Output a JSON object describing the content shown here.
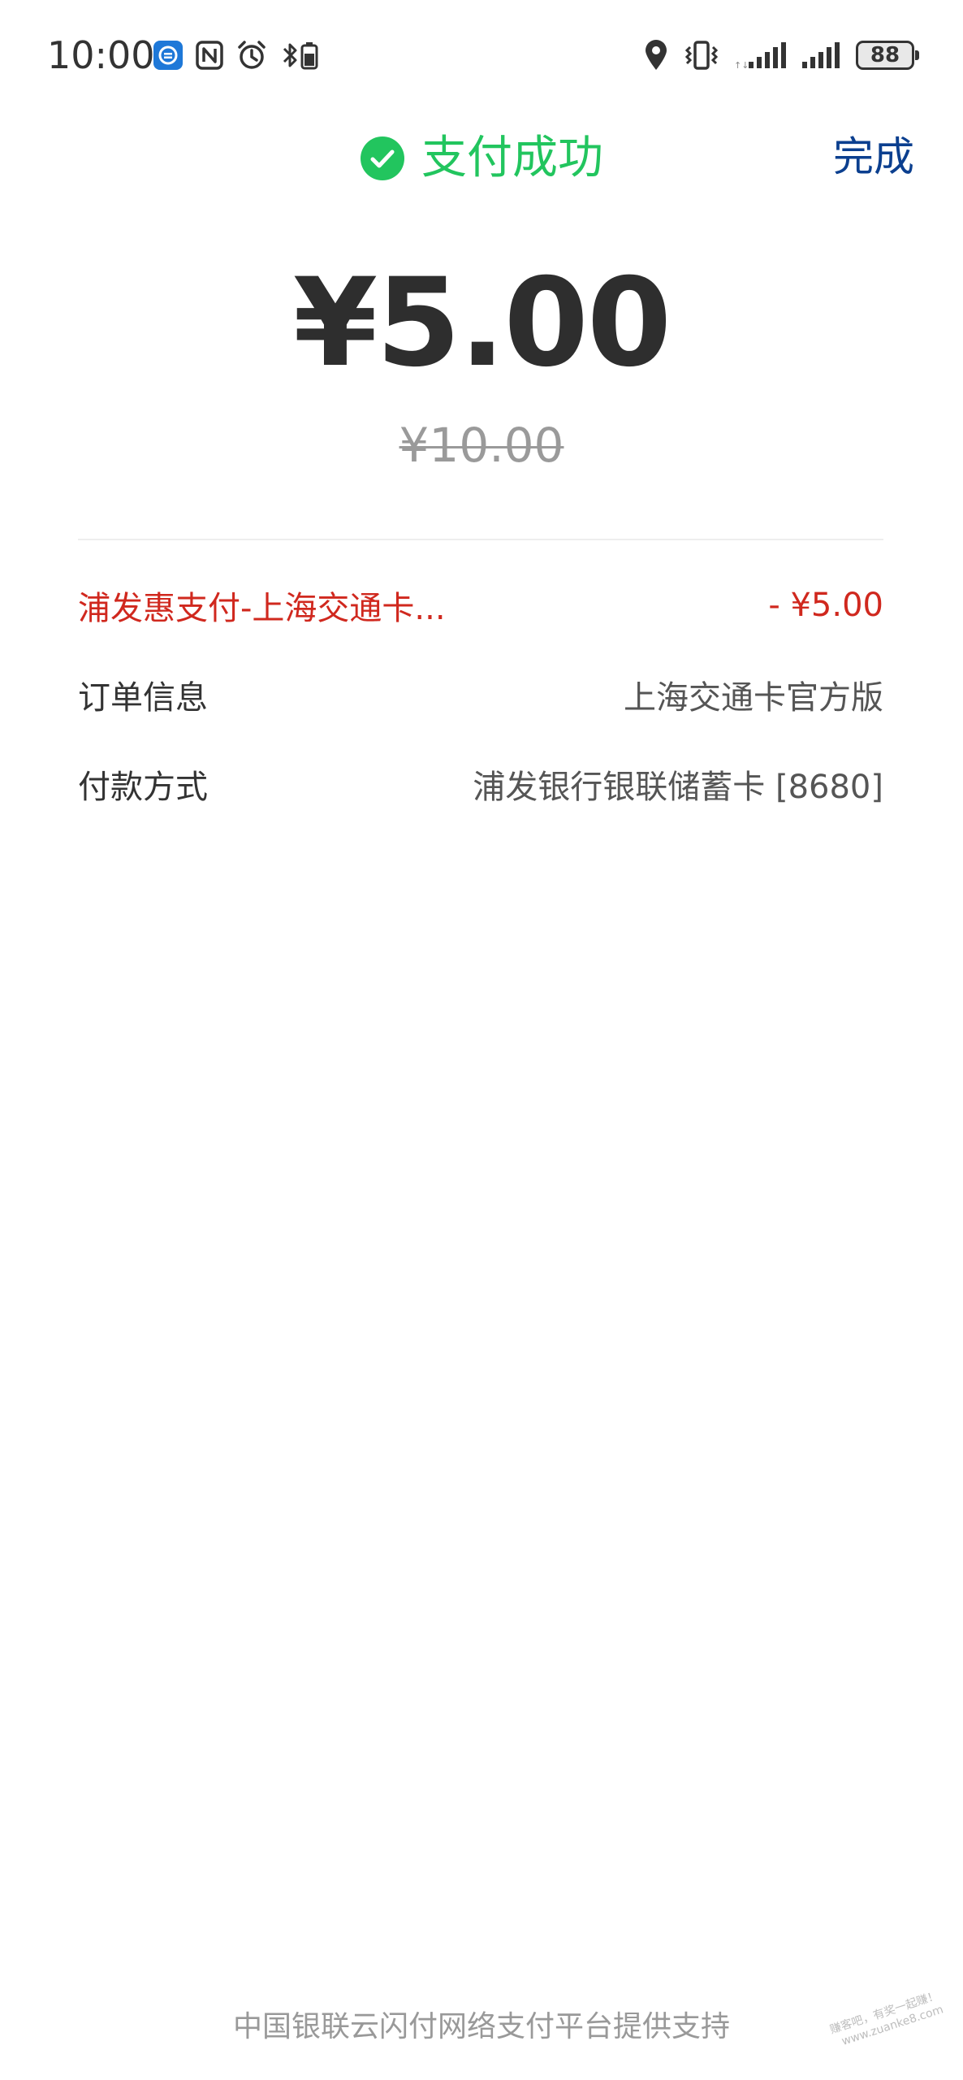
{
  "status_bar": {
    "time": "10:00",
    "battery": "88",
    "left_icons": [
      "app-notification-icon",
      "nfc-icon",
      "alarm-icon",
      "bluetooth-battery-icon"
    ],
    "right_icons": [
      "location-icon",
      "vibrate-icon",
      "signal-1-icon",
      "signal-2-icon",
      "battery-icon"
    ]
  },
  "header": {
    "title": "支付成功",
    "done_label": "完成",
    "success_color": "#22c55e",
    "done_color": "#0b3f8f"
  },
  "payment": {
    "amount": "¥5.00",
    "original_amount": "¥10.00"
  },
  "details": {
    "discount": {
      "label": "浦发惠支付-上海交通卡...",
      "value": "- ¥5.00",
      "color": "#d0281e"
    },
    "order": {
      "label": "订单信息",
      "value": "上海交通卡官方版"
    },
    "payment_method": {
      "label": "付款方式",
      "value": "浦发银行银联储蓄卡 [8680]"
    }
  },
  "footer": {
    "text": "中国银联云闪付网络支付平台提供支持"
  },
  "watermark": {
    "line1": "赚客吧，有奖一起赚！",
    "line2": "www.zuanke8.com"
  }
}
